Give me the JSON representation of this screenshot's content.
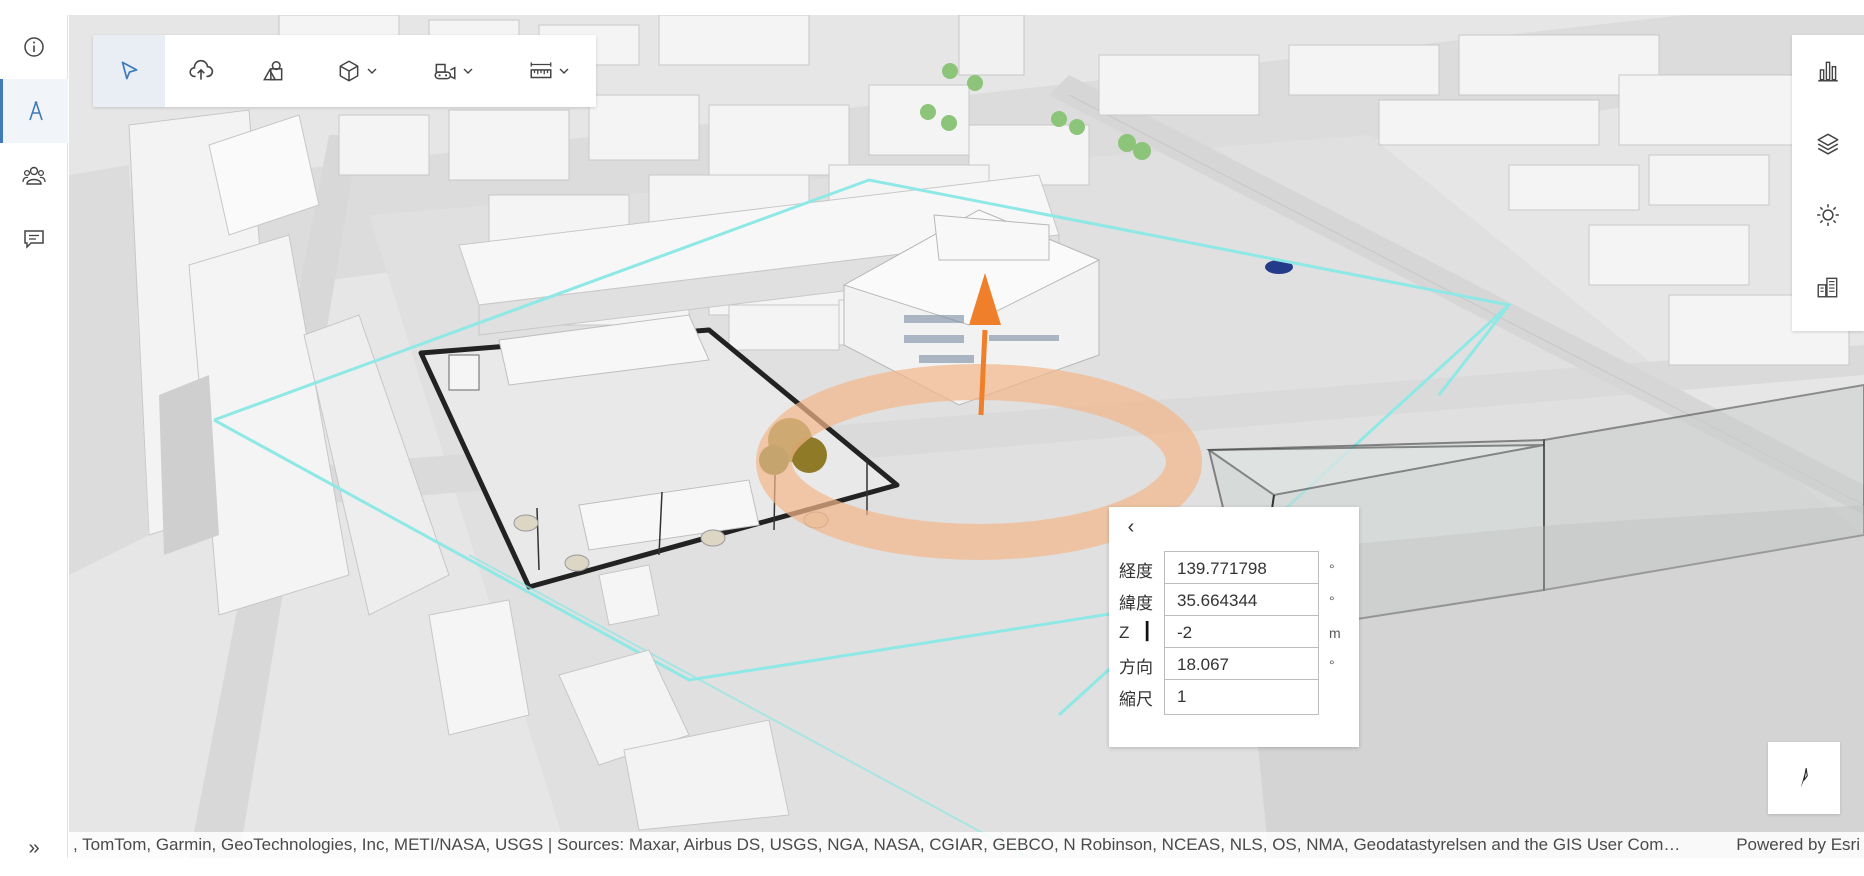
{
  "left_rail": {
    "items": [
      {
        "name": "info-icon"
      },
      {
        "name": "draw-icon",
        "active": true
      },
      {
        "name": "people-icon"
      },
      {
        "name": "comment-icon"
      }
    ],
    "expand_label": "»"
  },
  "toolbar": {
    "tools": [
      {
        "name": "select-icon",
        "active": true
      },
      {
        "name": "upload-icon"
      },
      {
        "name": "shapes-icon"
      },
      {
        "name": "cube-icon",
        "dropdown": true
      },
      {
        "name": "bulldozer-icon",
        "dropdown": true
      },
      {
        "name": "measure-icon",
        "dropdown": true
      }
    ]
  },
  "right_panel": {
    "items": [
      {
        "name": "chart-icon"
      },
      {
        "name": "layers-icon"
      },
      {
        "name": "sun-icon"
      },
      {
        "name": "buildings-icon"
      }
    ]
  },
  "popup": {
    "back_label": "‹",
    "fields": [
      {
        "label": "経度",
        "value": "139.771798",
        "unit": "°"
      },
      {
        "label": "緯度",
        "value": "35.664344",
        "unit": "°"
      },
      {
        "label": "Z",
        "value": "-2",
        "unit": "m"
      },
      {
        "label": "方向",
        "value": "18.067",
        "unit": "°"
      },
      {
        "label": "縮尺",
        "value": "1",
        "unit": ""
      }
    ]
  },
  "attribution": {
    "sources": ", TomTom, Garmin, GeoTechnologies, Inc, METI/NASA, USGS | Sources: Maxar, Airbus DS, USGS, NGA, NASA, CGIAR, GEBCO, N Robinson, NCEAS, NLS, OS, NMA, Geodatastyrelsen and the GIS User Com…",
    "powered_by": "Powered by Esri"
  },
  "colors": {
    "accent": "#3e7bb8",
    "gizmo_orange": "#ef7f2a",
    "boundary_cyan": "#8ee8e6",
    "ground": "#e3e3e3"
  }
}
